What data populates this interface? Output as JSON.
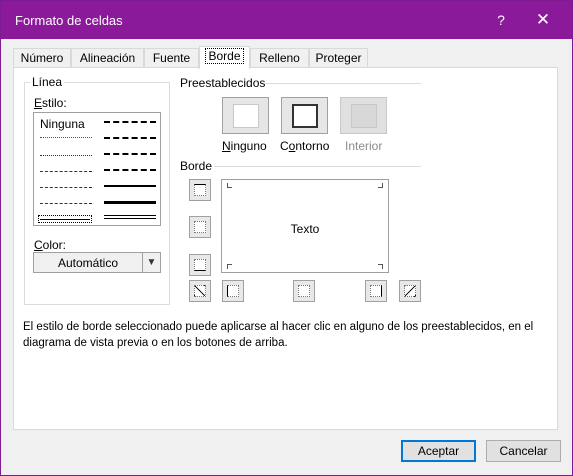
{
  "window": {
    "title": "Formato de celdas",
    "help_label": "?",
    "close_label": "✕"
  },
  "tabs": [
    {
      "label": "Número"
    },
    {
      "label": "Alineación"
    },
    {
      "label": "Fuente"
    },
    {
      "label": "Borde"
    },
    {
      "label": "Relleno"
    },
    {
      "label": "Proteger"
    }
  ],
  "active_tab": "Borde",
  "line": {
    "group_label": "Línea",
    "style_label": "Estilo:",
    "none_label": "Ninguna",
    "color_label": "Color:",
    "color_value": "Automático"
  },
  "presets": {
    "label": "Preestablecidos",
    "items": [
      {
        "label": "Ninguno",
        "enabled": true
      },
      {
        "label": "Contorno",
        "enabled": true
      },
      {
        "label": "Interior",
        "enabled": false
      }
    ]
  },
  "border": {
    "label": "Borde",
    "preview_text": "Texto"
  },
  "description": "El estilo de borde seleccionado puede aplicarse al hacer clic en alguno de los preestablecidos, en el diagrama de vista previa o en los botones de arriba.",
  "buttons": {
    "accept": "Aceptar",
    "cancel": "Cancelar"
  },
  "colors": {
    "titlebar": "#8b1a9a",
    "primary_button_border": "#0078d7"
  }
}
